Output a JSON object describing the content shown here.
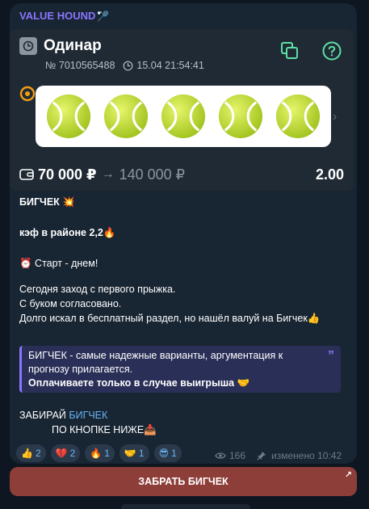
{
  "channel": {
    "name": "VALUE HOUND",
    "name_emoji": "🏸"
  },
  "bet_card": {
    "bet_type": "Одинар",
    "ticket_number": "№ 7010565488",
    "datetime": "15.04 21:54:41",
    "sport_icon": "tennis-ball",
    "stake": "70 000 ₽",
    "payout": "140 000 ₽",
    "odds": "2.00",
    "accent_color": "#5ce1a5"
  },
  "post": {
    "line1": "БИГЧЕК 💥",
    "line2": "кэф в районе 2,2🔥",
    "line3": "⏰ Старт - днем!",
    "line4": "Сегодня заход с первого прыжка.",
    "line5": "С буком согласовано.",
    "line6": "Долго искал в бесплатный раздел, но нашёл валуй на Бигчек👍",
    "quote_line1": "БИГЧЕК - самые надежные варианты, аргументация к",
    "quote_line2": "прогнозу прилагается.",
    "quote_bold": "Оплачиваете только в случае выигрыша 🤝",
    "cta_prefix": "ЗАБИРАЙ ",
    "cta_link": "БИГЧЕК",
    "cta_line2": "ПО КНОПКЕ НИЖЕ📥"
  },
  "reactions": [
    {
      "emoji": "👍",
      "count": "2"
    },
    {
      "emoji": "💔",
      "count": "2"
    },
    {
      "emoji": "🔥",
      "count": "1"
    },
    {
      "emoji": "🤝",
      "count": "1"
    },
    {
      "emoji": "😎",
      "count": "1"
    }
  ],
  "post_meta": {
    "views": "166",
    "edited": "изменено 10:42"
  },
  "button": {
    "label": "ЗАБРАТЬ БИГЧЕК",
    "color": "#8e3e39"
  }
}
